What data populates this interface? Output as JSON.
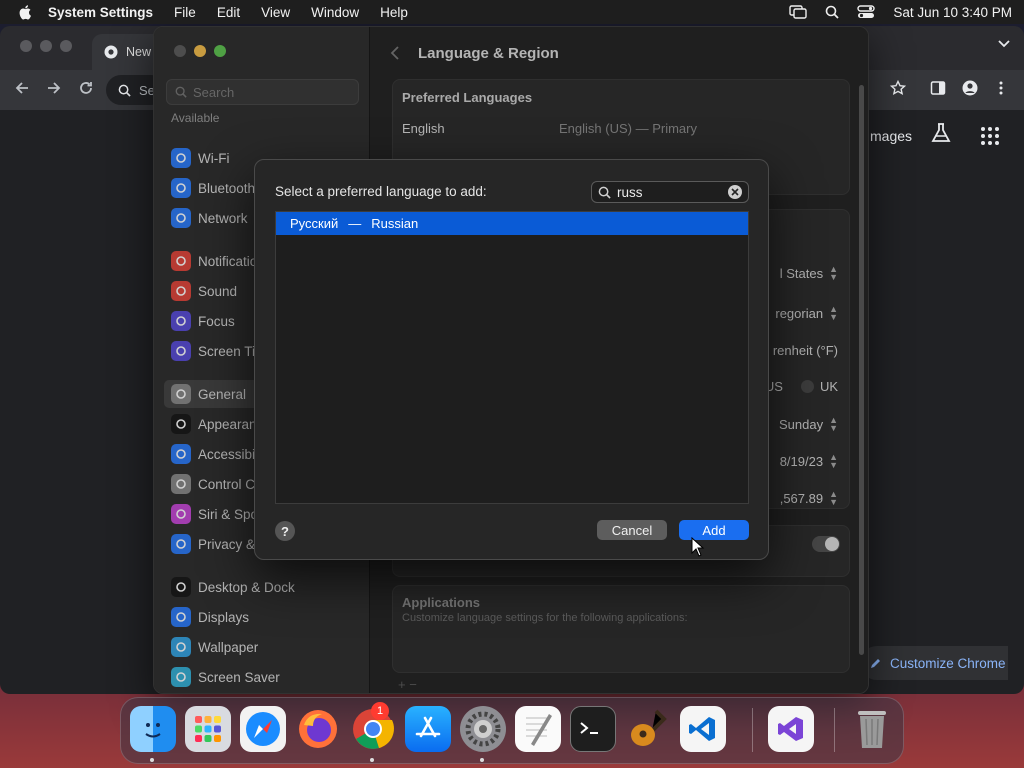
{
  "menubar": {
    "app_name": "System Settings",
    "menus": [
      "File",
      "Edit",
      "View",
      "Window",
      "Help"
    ],
    "datetime": "Sat Jun 10  3:40 PM"
  },
  "chrome": {
    "tab_title": "New",
    "omnibox_text": "Se",
    "images_link": "mages",
    "customize_label": "Customize Chrome"
  },
  "settings": {
    "search_placeholder": "Search",
    "available_label": "Available",
    "sidebar_items": [
      {
        "label": "Wi-Fi",
        "color": "#2f7cf6",
        "icon": "wifi-icon"
      },
      {
        "label": "Bluetooth",
        "color": "#2f7cf6",
        "icon": "bluetooth-icon"
      },
      {
        "label": "Network",
        "color": "#2f7cf6",
        "icon": "globe-icon"
      },
      {
        "label": "Notifications",
        "color": "#e0473d",
        "icon": "bell-icon"
      },
      {
        "label": "Sound",
        "color": "#e0473d",
        "icon": "speaker-icon"
      },
      {
        "label": "Focus",
        "color": "#5b4fd6",
        "icon": "moon-icon"
      },
      {
        "label": "Screen Time",
        "color": "#5b4fd6",
        "icon": "hourglass-icon"
      },
      {
        "label": "General",
        "color": "#8a8a8a",
        "icon": "gear-icon"
      },
      {
        "label": "Appearance",
        "color": "#1c1c1c",
        "icon": "appearance-icon"
      },
      {
        "label": "Accessibility",
        "color": "#2f7cf6",
        "icon": "accessibility-icon"
      },
      {
        "label": "Control Centre",
        "color": "#8a8a8a",
        "icon": "control-centre-icon"
      },
      {
        "label": "Siri & Spotlight",
        "color": "#c64bd6",
        "icon": "siri-icon"
      },
      {
        "label": "Privacy & Security",
        "color": "#2f7cf6",
        "icon": "hand-icon"
      },
      {
        "label": "Desktop & Dock",
        "color": "#1c1c1c",
        "icon": "dock-icon"
      },
      {
        "label": "Displays",
        "color": "#2f7cf6",
        "icon": "display-icon"
      },
      {
        "label": "Wallpaper",
        "color": "#38a3e0",
        "icon": "wallpaper-icon"
      },
      {
        "label": "Screen Saver",
        "color": "#38b0d6",
        "icon": "screensaver-icon"
      }
    ],
    "page_title": "Language & Region",
    "preferred_languages_heading": "Preferred Languages",
    "language_row": {
      "name": "English",
      "detail": "English (US) — Primary"
    },
    "region_value": "l States",
    "calendar_value": "regorian",
    "temperature_value": "renheit (°F)",
    "measurement_options": [
      "US",
      "UK"
    ],
    "first_day_value": "Sunday",
    "date_format_value": "8/19/23",
    "number_format_value": ",567.89",
    "applications_heading": "Applications",
    "applications_desc": "Customize language settings for the following applications:",
    "add_remove": "+   −"
  },
  "dialog": {
    "prompt": "Select a preferred language to add:",
    "search_value": "russ",
    "results": [
      {
        "native": "Русский",
        "separator": "—",
        "english": "Russian",
        "selected": true
      }
    ],
    "help_label": "?",
    "cancel_label": "Cancel",
    "add_label": "Add"
  },
  "dock": {
    "apps": [
      "Finder",
      "Launchpad",
      "Safari",
      "Firefox",
      "Google Chrome",
      "App Store",
      "System Settings",
      "TextEdit",
      "Terminal",
      "GarageBand",
      "Visual Studio Code",
      "Visual Studio",
      "Trash"
    ],
    "system_settings_badge": "1"
  }
}
